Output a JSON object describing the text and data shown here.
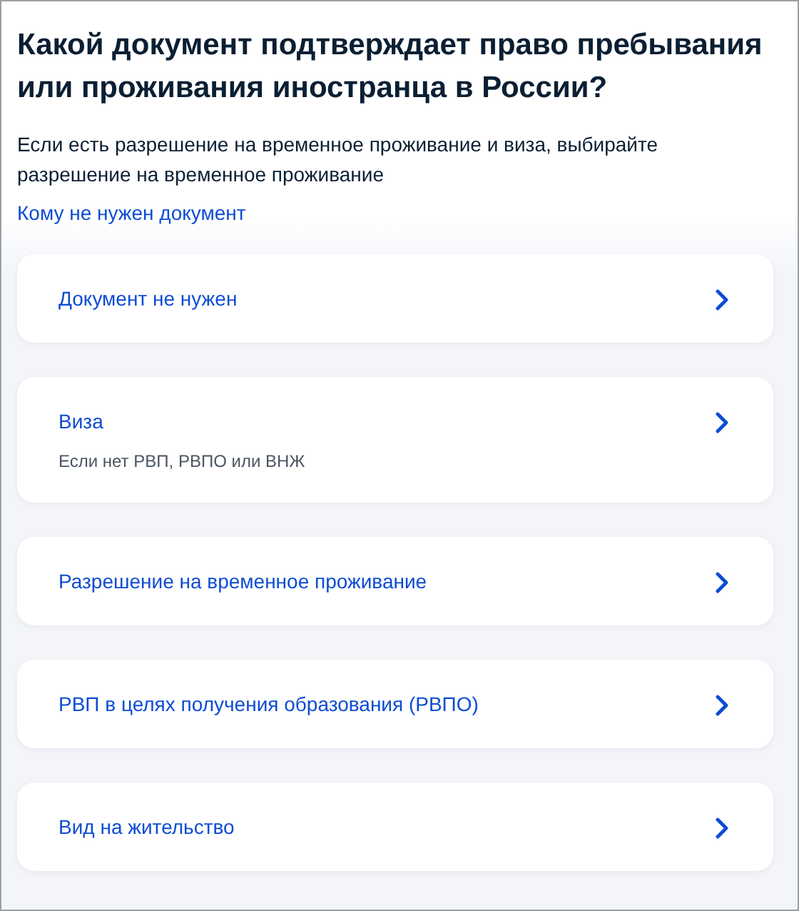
{
  "question": {
    "title": "Какой документ подтверждает право пребывания или проживания иностранца в России?",
    "hint": "Если есть разрешение на временное проживание и виза, выбирайте разрешение на временное проживание",
    "link": "Кому не нужен документ"
  },
  "options": [
    {
      "label": "Документ не нужен"
    },
    {
      "label": "Виза",
      "note": "Если нет РВП, РВПО или ВНЖ"
    },
    {
      "label": "Разрешение на временное проживание"
    },
    {
      "label": "РВП в целях получения образования (РВПО)"
    },
    {
      "label": "Вид на жительство"
    }
  ]
}
